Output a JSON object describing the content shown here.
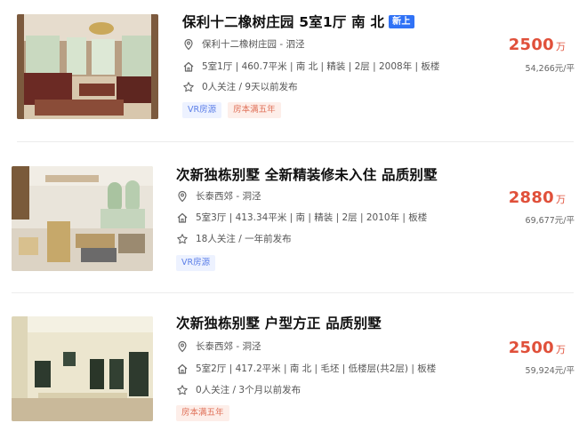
{
  "listings": [
    {
      "title": "保利十二橡树庄园 5室1厅 南 北",
      "badge": "新上",
      "location": "保利十二橡树庄园 - 泗泾",
      "house_info": "5室1厅 | 460.7平米 | 南 北 | 精装 | 2层 | 2008年 | 板楼",
      "follow_info": "0人关注 / 9天以前发布",
      "tags": [
        "VR房源",
        "房本满五年"
      ],
      "total_price": "2500",
      "price_unit": "万",
      "unit_price": "54,266元/平"
    },
    {
      "title": "次新独栋别墅 全新精装修未入住 品质别墅",
      "location": "长泰西郊 - 洞泾",
      "house_info": "5室3厅 | 413.34平米 | 南 | 精装 | 2层 | 2010年 | 板楼",
      "follow_info": "18人关注 / 一年前发布",
      "tags": [
        "VR房源"
      ],
      "total_price": "2880",
      "price_unit": "万",
      "unit_price": "69,677元/平"
    },
    {
      "title": "次新独栋别墅 户型方正 品质别墅",
      "location": "长泰西郊 - 洞泾",
      "house_info": "5室2厅 | 417.2平米 | 南 北 | 毛坯 | 低楼层(共2层) | 板楼",
      "follow_info": "0人关注 / 3个月以前发布",
      "tags": [
        "房本满五年"
      ],
      "total_price": "2500",
      "price_unit": "万",
      "unit_price": "59,924元/平"
    }
  ],
  "colors": {
    "price": "#e0503a",
    "badge_new": "#3072f6",
    "tag_vr_text": "#5b7ee8",
    "tag_tax_text": "#e0725a"
  },
  "icons": [
    "location-pin-icon",
    "house-icon",
    "star-icon"
  ]
}
